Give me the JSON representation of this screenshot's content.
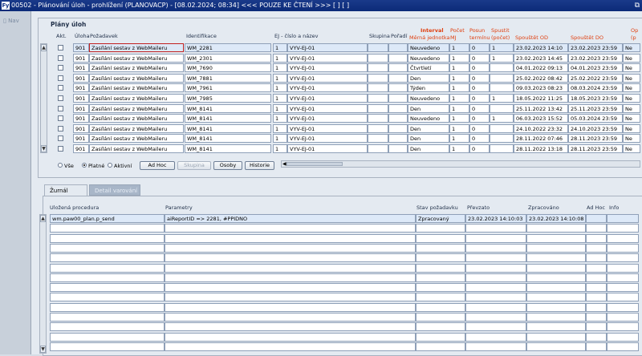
{
  "window": {
    "title": "00502 - Plánování úloh - prohlížení (PLANOVACP) - [08.02.2024; 08:34] <<< POUZE KE ČTENÍ >>> [ ] [ ]",
    "app_icon": "Fy",
    "restore_icon": "restore-icon"
  },
  "nav": {
    "label": "Nav"
  },
  "plans": {
    "title": "Plány úloh",
    "headers": {
      "akt": "Akt.",
      "uloha": "Úloha",
      "pozadavek": "Požadavek",
      "identifikace": "Identifikace",
      "ej": "EJ - číslo a název",
      "skupina": "Skupina",
      "poradi": "Pořadí",
      "interval": "Interval",
      "merna": "Měrná jednotka",
      "pocet": "Počet",
      "mj": "MJ",
      "posun": "Posun",
      "terminu": "termínu",
      "spustit": "Spustit",
      "spustit2": "(počet)",
      "spustet_od": "Spouštět OD",
      "spustet_do": "Spouštět DO",
      "op": "Op",
      "op2": "(p"
    },
    "rows": [
      {
        "uloha": "901",
        "pozadavek": "Zasílání sestav z WebMaileru",
        "ident": "WM_2281",
        "ej_num": "1",
        "ej_name": "VYV-EJ-01",
        "interval": "Neuvedeno",
        "pocet": "1",
        "posun": "0",
        "spustit": "1",
        "od": "23.02.2023 14:10",
        "do": "23.02.2023 23:59",
        "op": "Ne"
      },
      {
        "uloha": "901",
        "pozadavek": "Zasílání sestav z WebMaileru",
        "ident": "WM_2301",
        "ej_num": "1",
        "ej_name": "VYV-EJ-01",
        "interval": "Neuvedeno",
        "pocet": "1",
        "posun": "0",
        "spustit": "1",
        "od": "23.02.2023 14:45",
        "do": "23.02.2023 23:59",
        "op": "Ne"
      },
      {
        "uloha": "901",
        "pozadavek": "Zasílání sestav z WebMaileru",
        "ident": "WM_7690",
        "ej_num": "1",
        "ej_name": "VYV-EJ-01",
        "interval": "Čtvrtletí",
        "pocet": "1",
        "posun": "0",
        "spustit": "",
        "od": "04.01.2022 09:13",
        "do": "04.01.2023 23:59",
        "op": "Ne"
      },
      {
        "uloha": "901",
        "pozadavek": "Zasílání sestav z WebMaileru",
        "ident": "WM_7881",
        "ej_num": "1",
        "ej_name": "VYV-EJ-01",
        "interval": "Den",
        "pocet": "1",
        "posun": "0",
        "spustit": "",
        "od": "25.02.2022 08:42",
        "do": "25.02.2022 23:59",
        "op": "Ne"
      },
      {
        "uloha": "901",
        "pozadavek": "Zasílání sestav z WebMaileru",
        "ident": "WM_7961",
        "ej_num": "1",
        "ej_name": "VYV-EJ-01",
        "interval": "Týden",
        "pocet": "1",
        "posun": "0",
        "spustit": "",
        "od": "09.03.2023 08:23",
        "do": "08.03.2024 23:59",
        "op": "Ne"
      },
      {
        "uloha": "901",
        "pozadavek": "Zasílání sestav z WebMaileru",
        "ident": "WM_7985",
        "ej_num": "1",
        "ej_name": "VYV-EJ-01",
        "interval": "Neuvedeno",
        "pocet": "1",
        "posun": "0",
        "spustit": "1",
        "od": "18.05.2022 11:25",
        "do": "18.05.2023 23:59",
        "op": "Ne"
      },
      {
        "uloha": "901",
        "pozadavek": "Zasílání sestav z WebMaileru",
        "ident": "WM_8141",
        "ej_num": "1",
        "ej_name": "VYV-EJ-01",
        "interval": "Den",
        "pocet": "1",
        "posun": "0",
        "spustit": "",
        "od": "25.11.2022 13:42",
        "do": "25.11.2023 23:59",
        "op": "Ne"
      },
      {
        "uloha": "901",
        "pozadavek": "Zasílání sestav z WebMaileru",
        "ident": "WM_8141",
        "ej_num": "1",
        "ej_name": "VYV-EJ-01",
        "interval": "Neuvedeno",
        "pocet": "1",
        "posun": "0",
        "spustit": "1",
        "od": "06.03.2023 15:52",
        "do": "05.03.2024 23:59",
        "op": "Ne"
      },
      {
        "uloha": "901",
        "pozadavek": "Zasílání sestav z WebMaileru",
        "ident": "WM_8141",
        "ej_num": "1",
        "ej_name": "VYV-EJ-01",
        "interval": "Den",
        "pocet": "1",
        "posun": "0",
        "spustit": "",
        "od": "24.10.2022 23:32",
        "do": "24.10.2023 23:59",
        "op": "Ne"
      },
      {
        "uloha": "901",
        "pozadavek": "Zasílání sestav z WebMaileru",
        "ident": "WM_8141",
        "ej_num": "1",
        "ej_name": "VYV-EJ-01",
        "interval": "Den",
        "pocet": "1",
        "posun": "0",
        "spustit": "",
        "od": "28.11.2022 07:46",
        "do": "28.11.2023 23:59",
        "op": "Ne"
      },
      {
        "uloha": "901",
        "pozadavek": "Zasílání sestav z WebMaileru",
        "ident": "WM_8141",
        "ej_num": "1",
        "ej_name": "VYV-EJ-01",
        "interval": "Den",
        "pocet": "1",
        "posun": "0",
        "spustit": "",
        "od": "28.11.2022 13:18",
        "do": "28.11.2023 23:59",
        "op": "Ne"
      }
    ],
    "filter": {
      "vse": "Vše",
      "platne": "Platné",
      "aktivni": "Aktivní",
      "selected": "platne"
    },
    "buttons": {
      "adhoc": "Ad Hoc",
      "skupina": "Skupina",
      "osoby": "Osoby",
      "historie": "Historie"
    }
  },
  "tabs": {
    "zurnal": "Žurnál",
    "detail": "Detail varování"
  },
  "journal": {
    "headers": {
      "procedura": "Uložená procedura",
      "parametry": "Parametry",
      "stav": "Stav požadavku",
      "prevzato": "Převzato",
      "zpracovano": "Zpracováno",
      "adhoc": "Ad Hoc",
      "info": "Info"
    },
    "rows": [
      {
        "procedura": "wm.paw00_plan.p_send",
        "parametry": "aiReportID => 2281, #PPIDNO",
        "stav": "Zpracovaný",
        "prevzato": "23.02.2023 14:10:03",
        "zpracovano": "23.02.2023 14:10:08",
        "adhoc": "",
        "info": ""
      }
    ]
  }
}
